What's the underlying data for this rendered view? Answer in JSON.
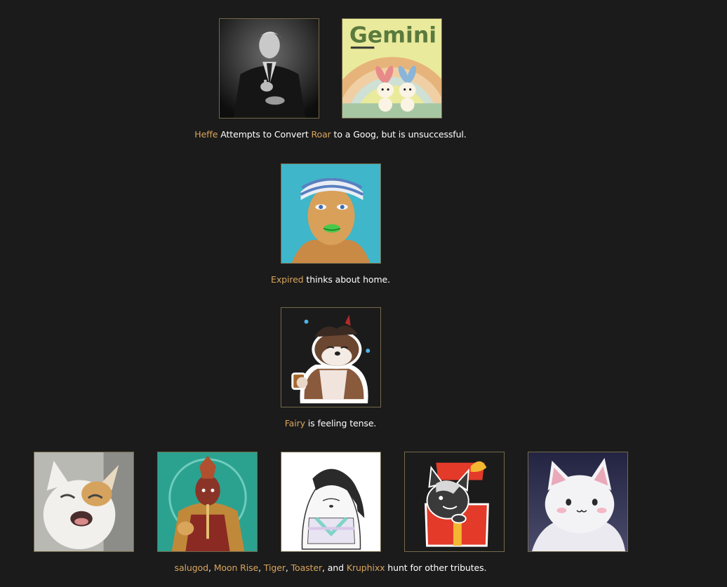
{
  "events": [
    {
      "participants": [
        "Heffe",
        "Roar"
      ],
      "caption": {
        "name1": "Heffe",
        "text1": " Attempts to Convert ",
        "name2": "Roar",
        "text2": " to a Goog, but is unsuccessful."
      },
      "image_texts": {
        "gemini_title": "Gemini"
      }
    },
    {
      "participants": [
        "Expired"
      ],
      "caption": {
        "name1": "Expired",
        "text1": " thinks about home."
      }
    },
    {
      "participants": [
        "Fairy"
      ],
      "caption": {
        "name1": "Fairy",
        "text1": " is feeling tense."
      }
    },
    {
      "participants": [
        "salugod",
        "Moon Rise",
        "Tiger",
        "Toaster",
        "Kruphixx"
      ],
      "caption": {
        "name1": "salugod",
        "sep1": ", ",
        "name2": "Moon Rise",
        "sep2": ", ",
        "name3": "Tiger",
        "sep3": ", ",
        "name4": "Toaster",
        "sep4": ", and ",
        "name5": "Kruphixx",
        "text_end": " hunt for other tributes."
      }
    }
  ],
  "colors": {
    "background": "#1b1b1b",
    "tribute_name": "#d9a55b",
    "text": "#ffffff",
    "avatar_border": "#74694a"
  }
}
